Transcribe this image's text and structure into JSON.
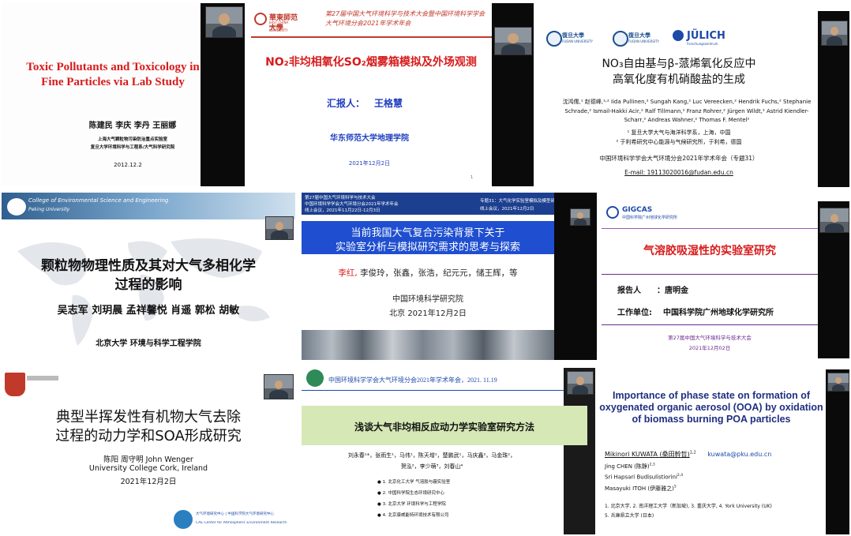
{
  "colors": {
    "red": "#d81b1b",
    "blue": "#1f3fbf",
    "dark": "#111111",
    "green_band": "#d5e8b5",
    "purple": "#6b2a8e",
    "header_blue": "#1d4aa8"
  },
  "slides": [
    {
      "title_en": "Toxic Pollutants and Toxicology in Fine Particles via Lab Study",
      "authors": "陈建民 李庆 李丹 王丽娜",
      "lab": "上海大气颗粒物污染防治重点实验室",
      "dept": "复旦大学环境科学与工程系/大气科学研究院",
      "date": "2012.12.2"
    },
    {
      "header": "第27届中国大气环境科学与技术大会暨中国环境科学学会大气环境分会2021年学术年会",
      "title": "NO₂非均相氧化SO₂烟雾箱模拟及外场观测",
      "reporter_label": "汇报人：",
      "reporter": "王格慧",
      "affiliation": "华东师范大学地理学院",
      "date": "2021年12月2日",
      "page_no": "1"
    },
    {
      "logo_right": "JÜLICH",
      "logo_right_sub": "Forschungszentrum",
      "logo_left": "FUDAN UNIVERSITY",
      "title_line1": "NO₃自由基与β-蒎烯氧化反应中",
      "title_line2": "高氧化度有机硝酸盐的生成",
      "authors": "沈鸿儒,¹ 赵德峰,¹˒² Iida Pullinen,² Sungah Kang,² Luc Vereecken,² Hendrik Fuchs,² Stephanie Schrade,² Ismail-Hakki Acir,² Ralf Tillmann,² Franz Rohrer,² Jürgen Wildt,² Astrid Kiendler-Scharr,² Andreas Wahner,² Thomas F. Mentel²",
      "aff1": "¹ 复旦大学大气与海洋科学系，上海，中国",
      "aff2": "² 于利希研究中心能源与气候研究所，于利希，德国",
      "conference": "中国环境科学学会大气环境分会2021年学术年会（专题31）",
      "email": "E-mail: 19113020016@fudan.edu.cn"
    },
    {
      "school_en": "College of Environmental Science and Engineering",
      "school_en2": "Peking University",
      "title_line1": "颗粒物物理性质及其对大气多相化学",
      "title_line2": "过程的影响",
      "authors": "吴志军 刘玥晨 孟祥馨悦 肖遥 郭松 胡敏",
      "affiliation": "北京大学 环境与科学工程学院"
    },
    {
      "top1": "第27届中国大气环境科学与技术大会",
      "top2": "中国环境科学学会大气环境分会2021年学术年会",
      "top3": "线上会议，2021年11月22日-12月3日",
      "top_right1": "专题31：大气化学实验室模拟及模型研究",
      "top_right2": "线上会议，2021年12月2日",
      "title_line1": "当前我国大气复合污染背景下关于",
      "title_line2": "实验室分析与模拟研究需求的思考与探索",
      "author_red": "李红,",
      "authors_rest": "李俊玲，张鑫，张浩，纪元元，储王辉，等",
      "institute": "中国环境科学研究院",
      "date": "北京 2021年12月2日"
    },
    {
      "logo": "GIGCAS",
      "logo_sub": "中国科学院广州地球化学研究所",
      "title": "气溶胶吸湿性的实验室研究",
      "reporter_label": "报告人",
      "reporter": "：唐明金",
      "unit_label": "工作单位:",
      "unit": "中国科学院广州地球化学研究所",
      "conf": "第27届中国大气环境科学与技术大会",
      "date": "2021年12月02日"
    },
    {
      "title_line1": "典型半挥发性有机物大气去除",
      "title_line2": "过程的动力学和SOA形成研究",
      "authors": "陈阳 周守明  John Wenger",
      "univ": "University College Cork, Ireland",
      "date": "2021年12月2日",
      "footer_cn": "大气环境研究中心 | 中国科学院大气环境研究中心",
      "footer_en": "CAE Center for Atmospheric Environment Research"
    },
    {
      "header": "中国环境科学学会大气环境分会2021年学术年会，2021. 11.19",
      "title": "浅谈大气非均相反应动力学实验室研究方法",
      "authors1": "刘永春¹*，张雨生¹，马伟¹，陈天增¹，楚鹏武¹，马庆鑫²，马金珠²，",
      "authors2": "贺泓²，李少萌³，刘春山⁴",
      "aff": [
        "1. 北京化工大学 气溶胶与霾实验室",
        "2. 中国科学院生态环境研究中心",
        "3. 北京大学 环境科学与工程学院",
        "4. 北京康威能特环境技术有限公司"
      ]
    },
    {
      "title": "Importance of phase state on formation of oxygenated organic aerosol (OOA) by oxidation of biomass burning POA particles",
      "author1": "Mikinori KUWATA  (桑田幹哲)",
      "author1_sup": "1,2",
      "email": "kuwata@pku.edu.cn",
      "author2": "Jing CHEN (陈静)",
      "author2_sup": "2,3",
      "author3": "Sri Hapsari Budisulistiorini",
      "author3_sup": "2,4",
      "author4": "Masayuki ITOH (伊藤雅之)",
      "author4_sup": "5",
      "aff1": "1. 北京大学, 2. 南洋理工大学（新加坡), 3. 重庆大学, 4. York University (UK)",
      "aff2": "5. 兵庫県立大学 (日本)"
    }
  ]
}
